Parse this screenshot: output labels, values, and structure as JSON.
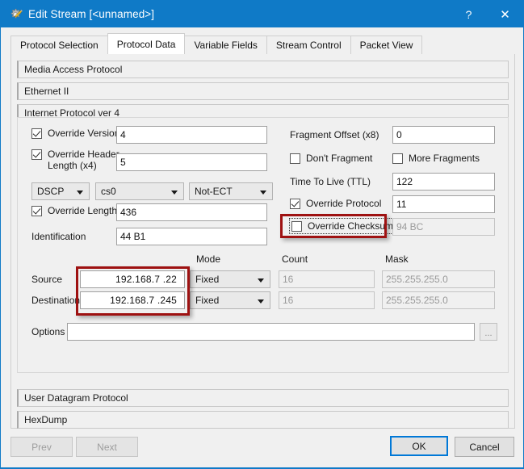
{
  "window": {
    "title": "Edit Stream [<unnamed>]",
    "icon": "gear-pencil-icon",
    "accent_color": "#0f7ac7",
    "help_label": "?",
    "close_label": "✕"
  },
  "tabs": [
    {
      "label": "Protocol Selection",
      "active": false
    },
    {
      "label": "Protocol Data",
      "active": true
    },
    {
      "label": "Variable Fields",
      "active": false
    },
    {
      "label": "Stream Control",
      "active": false
    },
    {
      "label": "Packet View",
      "active": false
    }
  ],
  "protocol_sections": [
    {
      "label": "Media Access Protocol"
    },
    {
      "label": "Ethernet II"
    },
    {
      "label": "Internet Protocol ver 4"
    },
    {
      "label": "User Datagram Protocol"
    },
    {
      "label": "HexDump"
    }
  ],
  "ipv4": {
    "override_version": {
      "label": "Override Version",
      "checked": true,
      "value": "4"
    },
    "override_header_length": {
      "label": "Override Header\nLength (x4)",
      "checked": true,
      "value": "5"
    },
    "dscp_mode": "DSCP",
    "dscp_value": "cs0",
    "ecn_value": "Not-ECT",
    "override_length": {
      "label": "Override Length",
      "checked": true,
      "value": "436"
    },
    "identification": {
      "label": "Identification",
      "value": "44 B1"
    },
    "fragment_offset": {
      "label": "Fragment Offset (x8)",
      "value": "0"
    },
    "dont_fragment": {
      "label": "Don't Fragment",
      "checked": false
    },
    "more_fragments": {
      "label": "More Fragments",
      "checked": false
    },
    "ttl": {
      "label": "Time To Live (TTL)",
      "value": "122"
    },
    "override_protocol": {
      "label": "Override Protocol",
      "checked": true,
      "value": "11"
    },
    "override_checksum": {
      "label": "Override Checksum",
      "checked": false,
      "value": "94 BC",
      "disabled": true,
      "focused": true
    },
    "address_table": {
      "headers": [
        "",
        "",
        "Mode",
        "Count",
        "Mask"
      ],
      "rows": [
        {
          "label": "Source",
          "address": "192.168.7 .22",
          "mode": "Fixed",
          "count": "16",
          "mask": "255.255.255.0"
        },
        {
          "label": "Destination",
          "address": "192.168.7 .245",
          "mode": "Fixed",
          "count": "16",
          "mask": "255.255.255.0"
        }
      ]
    },
    "options": {
      "label": "Options",
      "value": "",
      "browse_label": "..."
    }
  },
  "annotations": {
    "color": "#9e1111",
    "boxes": [
      "override-checksum-highlight",
      "address-fields-highlight"
    ]
  },
  "footer": {
    "prev": {
      "label": "Prev",
      "disabled": true
    },
    "next": {
      "label": "Next",
      "disabled": true
    },
    "ok": {
      "label": "OK",
      "default": true
    },
    "cancel": {
      "label": "Cancel",
      "default": false
    }
  }
}
